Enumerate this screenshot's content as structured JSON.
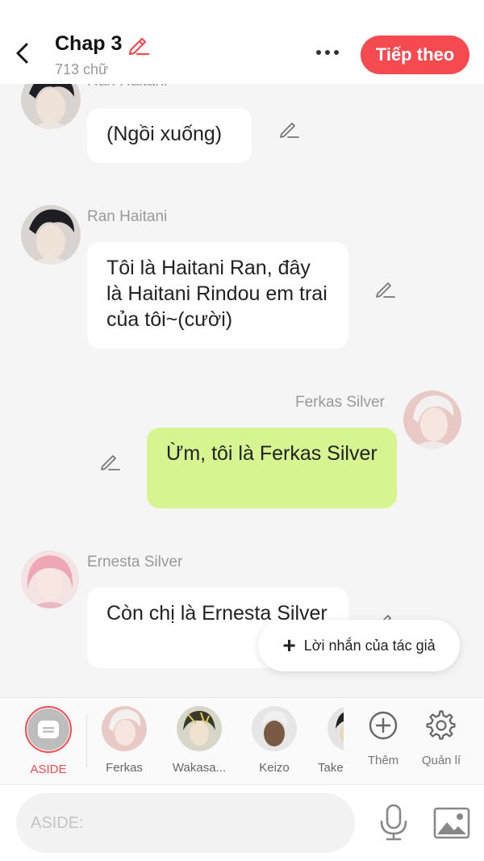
{
  "header": {
    "title": "Chap 3",
    "word_count": "713 chữ",
    "next_label": "Tiếp theo"
  },
  "messages": [
    {
      "sender": "Ran Haitani",
      "text": "(Ngồi xuống)",
      "side": "left",
      "avatar": "ran-haitani-avatar"
    },
    {
      "sender": "Ran Haitani",
      "text": "Tôi là Haitani Ran, đây là Haitani Rindou em trai của tôi~(cười)",
      "side": "left",
      "avatar": "ran-haitani-avatar"
    },
    {
      "sender": "Ferkas Silver",
      "text": "Ừm, tôi là Ferkas Silver",
      "side": "right",
      "avatar": "ferkas-silver-avatar"
    },
    {
      "sender": "Ernesta Silver",
      "text": "Còn chị là Ernesta Silver",
      "side": "left",
      "avatar": "ernesta-silver-avatar"
    }
  ],
  "author_note": {
    "label": "Lời nhắn của tác giả"
  },
  "characters": [
    {
      "label": "ASIDE",
      "selected": true
    },
    {
      "label": "Ferkas"
    },
    {
      "label": "Wakasa..."
    },
    {
      "label": "Keizo"
    },
    {
      "label": "Take"
    }
  ],
  "tools": {
    "add_label": "Thêm",
    "manage_label": "Quản lí"
  },
  "input": {
    "placeholder": "ASIDE:"
  },
  "colors": {
    "accent": "#f44a50",
    "my_bubble": "#d6f591",
    "bubble": "#ffffff",
    "background": "#f5f5f5"
  }
}
